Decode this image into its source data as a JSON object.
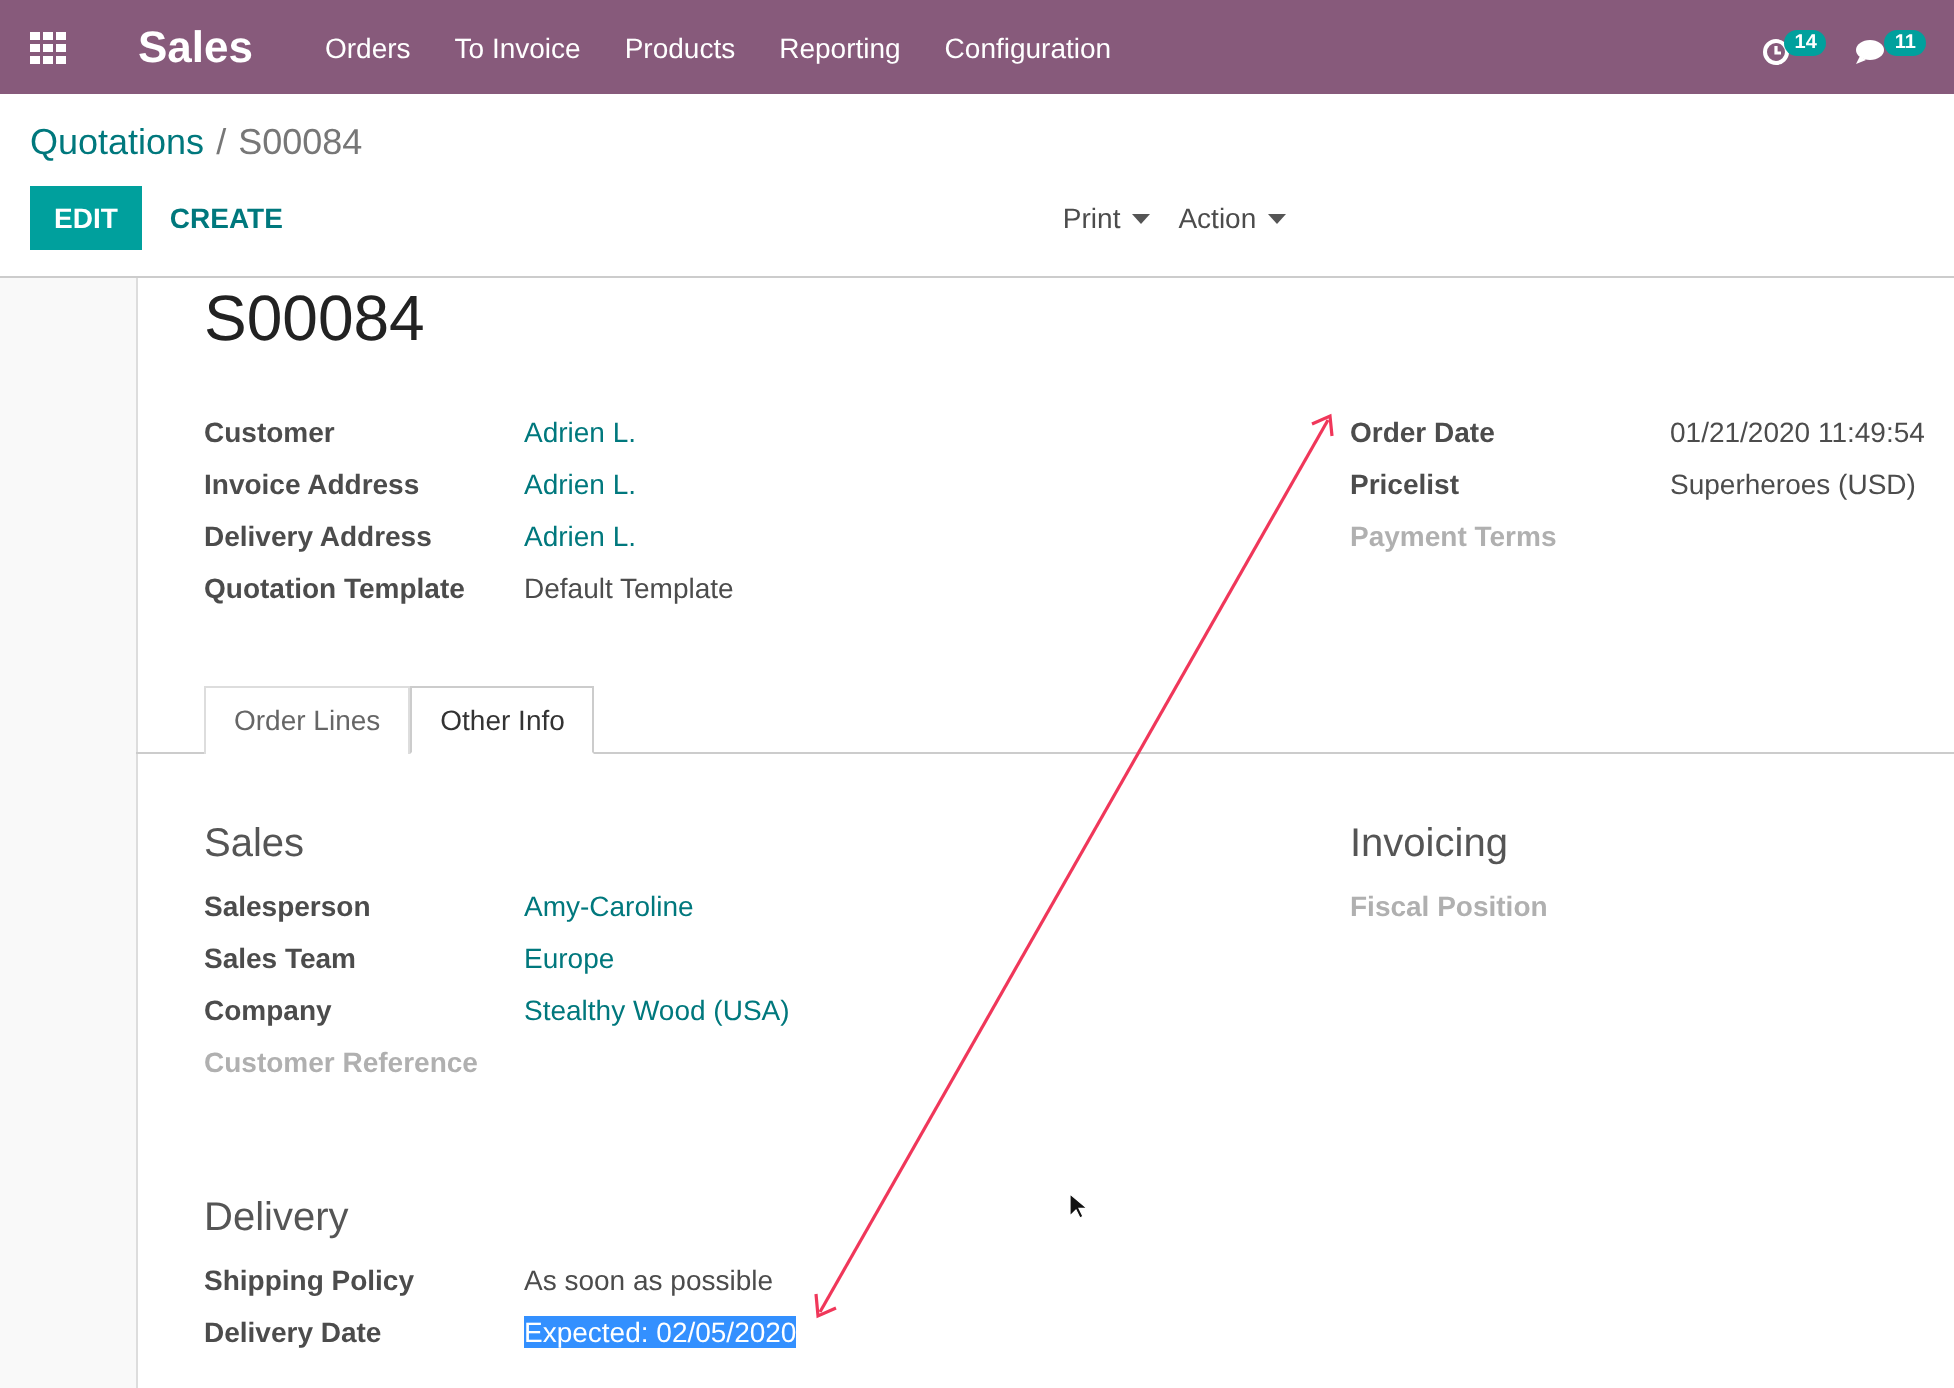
{
  "navbar": {
    "app_name": "Sales",
    "menu": [
      "Orders",
      "To Invoice",
      "Products",
      "Reporting",
      "Configuration"
    ],
    "activity_count": "14",
    "message_count": "11"
  },
  "breadcrumb": {
    "parent": "Quotations",
    "separator": "/",
    "current": "S00084"
  },
  "buttons": {
    "edit": "EDIT",
    "create": "CREATE",
    "print": "Print",
    "action": "Action"
  },
  "record_title": "S00084",
  "header_left": [
    {
      "label": "Customer",
      "value": "Adrien L.",
      "kind": "link"
    },
    {
      "label": "Invoice Address",
      "value": "Adrien L.",
      "kind": "link"
    },
    {
      "label": "Delivery Address",
      "value": "Adrien L.",
      "kind": "link"
    },
    {
      "label": "Quotation Template",
      "value": "Default Template",
      "kind": "plain"
    }
  ],
  "header_right": [
    {
      "label": "Order Date",
      "value": "01/21/2020 11:49:54",
      "kind": "plain"
    },
    {
      "label": "Pricelist",
      "value": "Superheroes (USD)",
      "kind": "plain"
    },
    {
      "label": "Payment Terms",
      "kind": "empty"
    }
  ],
  "tabs": [
    {
      "label": "Order Lines",
      "selected": false
    },
    {
      "label": "Other Info",
      "selected": true
    }
  ],
  "sections": [
    {
      "title": "Sales",
      "fields": [
        {
          "label": "Salesperson",
          "value": "Amy-Caroline",
          "kind": "link"
        },
        {
          "label": "Sales Team",
          "value": "Europe",
          "kind": "link"
        },
        {
          "label": "Company",
          "value": "Stealthy Wood (USA)",
          "kind": "link"
        },
        {
          "label": "Customer Reference",
          "kind": "empty"
        }
      ]
    },
    {
      "title": "Invoicing",
      "fields": [
        {
          "label": "Fiscal Position",
          "kind": "empty"
        }
      ]
    },
    {
      "title": "Delivery",
      "fields": [
        {
          "label": "Shipping Policy",
          "value": "As soon as possible",
          "kind": "plain"
        },
        {
          "label": "Delivery Date",
          "value": "Expected: 02/05/2020",
          "kind": "highlighted"
        }
      ]
    }
  ]
}
